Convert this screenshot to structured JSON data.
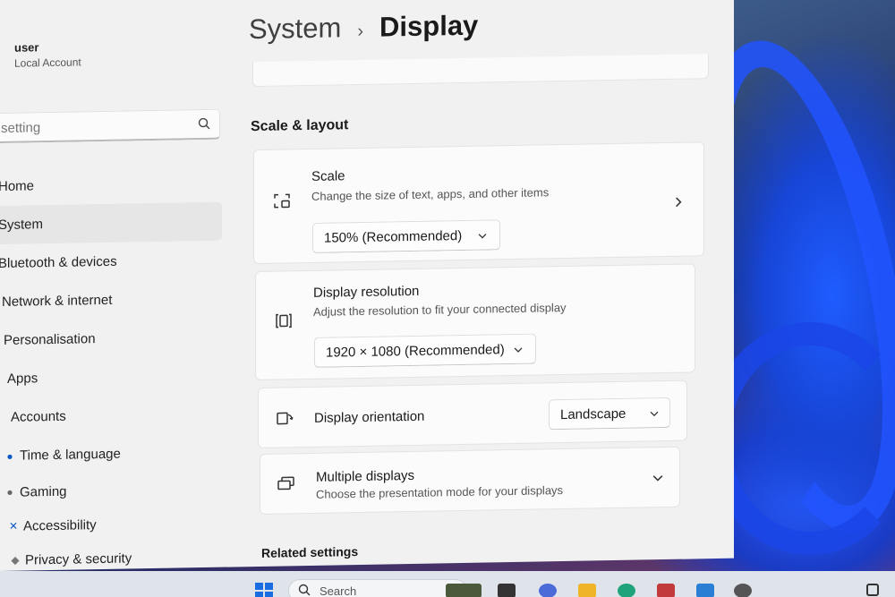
{
  "user": {
    "name": "user",
    "account": "Local Account"
  },
  "search": {
    "placeholder": "setting"
  },
  "nav": [
    {
      "label": "Home",
      "icon": "home-icon"
    },
    {
      "label": "System",
      "icon": "system-icon",
      "active": true
    },
    {
      "label": "Bluetooth & devices",
      "icon": "bluetooth-icon"
    },
    {
      "label": "Network & internet",
      "icon": "network-icon"
    },
    {
      "label": "Personalisation",
      "icon": "brush-icon"
    },
    {
      "label": "Apps",
      "icon": "apps-icon"
    },
    {
      "label": "Accounts",
      "icon": "accounts-icon"
    },
    {
      "label": "Time & language",
      "icon": "globe-icon"
    },
    {
      "label": "Gaming",
      "icon": "gaming-icon"
    },
    {
      "label": "Accessibility",
      "icon": "accessibility-icon"
    },
    {
      "label": "Privacy & security",
      "icon": "shield-icon"
    }
  ],
  "breadcrumb": {
    "parent": "System",
    "separator": "›",
    "current": "Display"
  },
  "section": {
    "title": "Scale & layout"
  },
  "scale": {
    "title": "Scale",
    "description": "Change the size of text, apps, and other items",
    "value": "150% (Recommended)"
  },
  "resolution": {
    "title": "Display resolution",
    "description": "Adjust the resolution to fit your connected display",
    "value": "1920 × 1080 (Recommended)"
  },
  "orientation": {
    "title": "Display orientation",
    "value": "Landscape"
  },
  "multiple": {
    "title": "Multiple displays",
    "description": "Choose the presentation mode for your displays"
  },
  "related": {
    "title": "Related settings"
  },
  "taskbar": {
    "search_label": "Search"
  },
  "colors": {
    "accent": "#0a58c8",
    "window_bg": "#f1f1f1",
    "card_bg": "#fbfbfb"
  }
}
